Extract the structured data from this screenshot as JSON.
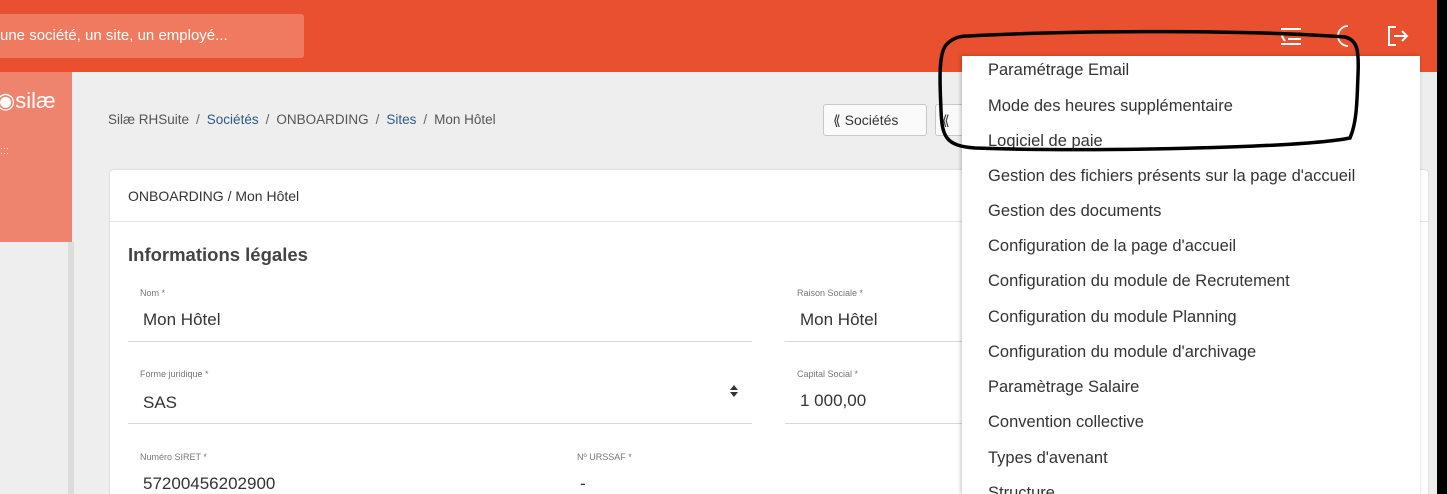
{
  "topbar": {
    "search_placeholder": "une société, un site, un employé...",
    "icons": [
      "menu-icon",
      "moon-icon",
      "logout-icon"
    ]
  },
  "sidebar": {
    "logo_text": "◉silæ",
    "tiny_text": "...\n..."
  },
  "breadcrumb": {
    "items": [
      {
        "label": "Silæ RHSuite",
        "link": false
      },
      {
        "label": "Sociétés",
        "link": true
      },
      {
        "label": "ONBOARDING",
        "link": false
      },
      {
        "label": "Sites",
        "link": true
      },
      {
        "label": "Mon Hôtel",
        "link": false
      }
    ],
    "separator": "/"
  },
  "nav": {
    "back_societes": "⟪ Sociétés",
    "back_partial": "⟪"
  },
  "card": {
    "header": "ONBOARDING / Mon Hôtel",
    "section_title": "Informations légales",
    "fields": {
      "nom": {
        "label": "Nom *",
        "value": "Mon Hôtel"
      },
      "raison": {
        "label": "Raison Sociale *",
        "value": "Mon Hôtel"
      },
      "forme": {
        "label": "Forme juridique *",
        "value": "SAS"
      },
      "capital": {
        "label": "Capital Social *",
        "value": "1 000,00"
      },
      "siret": {
        "label": "Numéro SIRET *",
        "value": "57200456202900"
      },
      "urssaf": {
        "label": "Nº URSSAF *",
        "value": "-"
      }
    }
  },
  "menu": {
    "items": [
      "Paramétrage Email",
      "Mode des heures supplémentaire",
      "Logiciel de paie",
      "Gestion des fichiers présents sur la page d'accueil",
      "Gestion des documents",
      "Configuration de la page d'accueil",
      "Configuration du module de Recrutement",
      "Configuration du module Planning",
      "Configuration du module d'archivage",
      "Paramètrage Salaire",
      "Convention collective",
      "Types d'avenant",
      "Structure"
    ]
  },
  "colors": {
    "brand": "#e8502f",
    "link": "#2d5a8a"
  }
}
